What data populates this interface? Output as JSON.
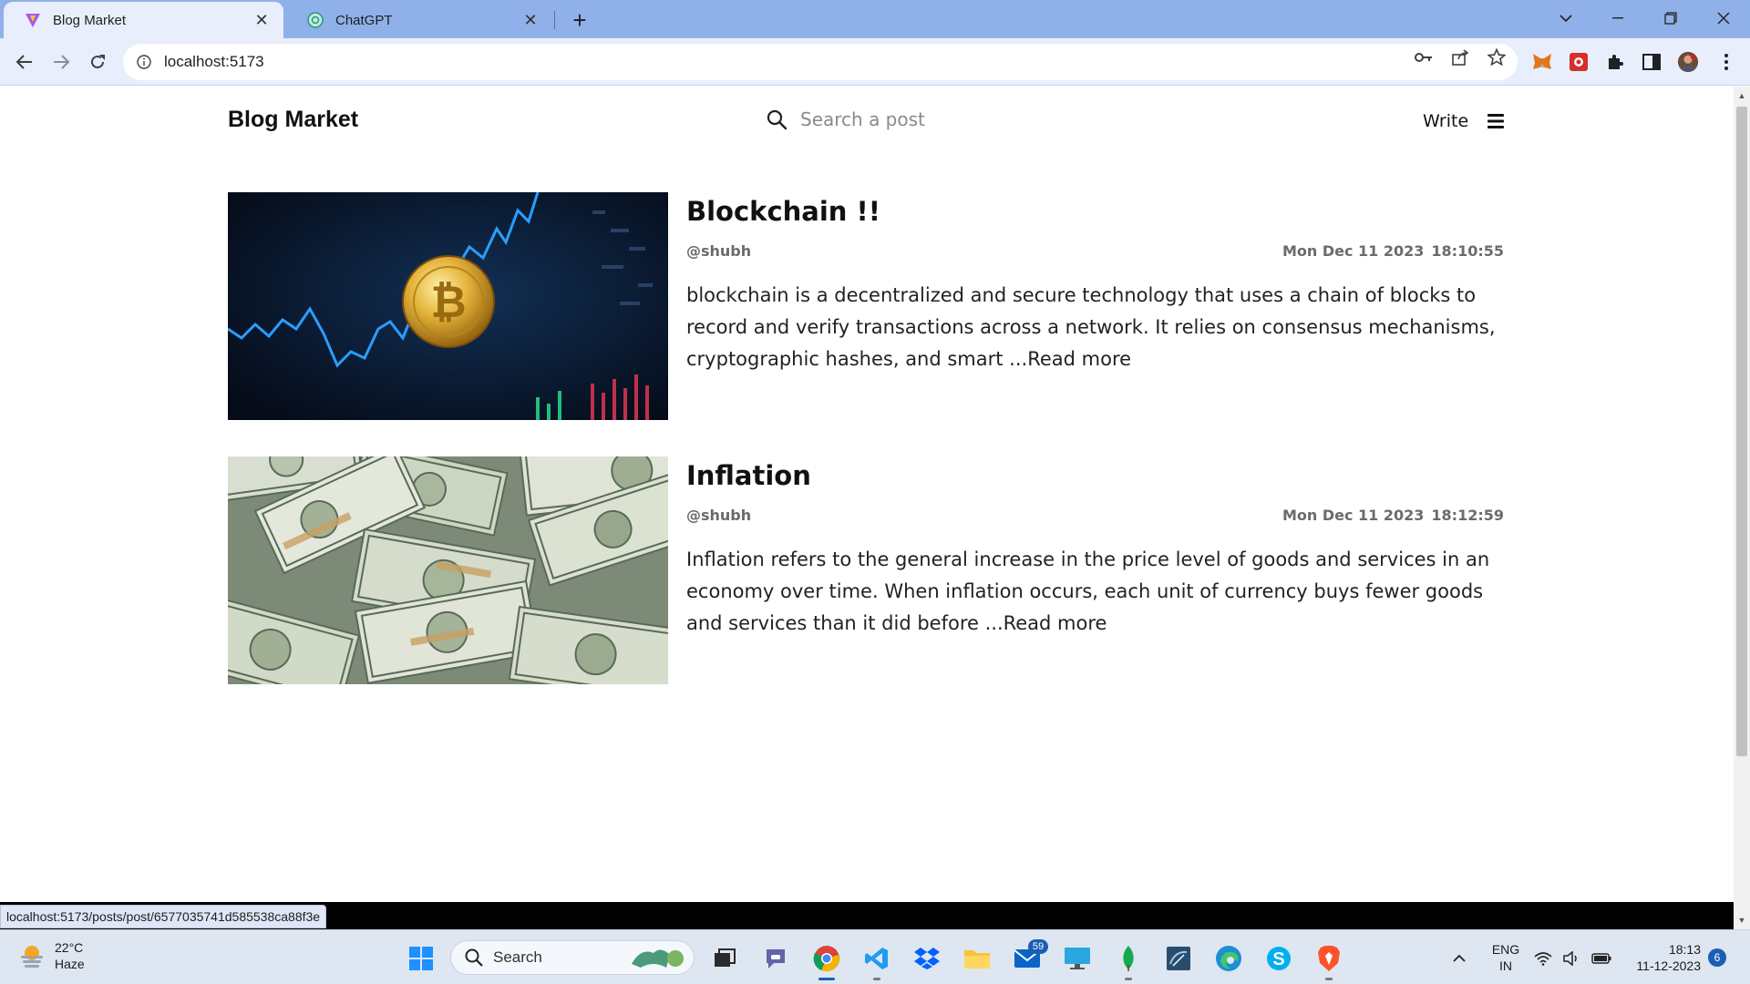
{
  "browser": {
    "tabs": [
      {
        "title": "Blog Market",
        "active": true
      },
      {
        "title": "ChatGPT",
        "active": false
      }
    ],
    "url": "localhost:5173",
    "status_url": "localhost:5173/posts/post/6577035741d585538ca88f3e"
  },
  "site": {
    "logo": "Blog Market",
    "search_placeholder": "Search a post",
    "write_label": "Write"
  },
  "posts": [
    {
      "title": "Blockchain !!",
      "author": "@shubh",
      "date": "Mon Dec 11 2023",
      "time": "18:10:55",
      "excerpt": "blockchain is a decentralized and secure technology that uses a chain of blocks to record and verify transactions across a network. It relies on consensus mechanisms, cryptographic hashes, and smart ...Read more",
      "image": "bitcoin-chart-image"
    },
    {
      "title": "Inflation",
      "author": "@shubh",
      "date": "Mon Dec 11 2023",
      "time": "18:12:59",
      "excerpt": "Inflation refers to the general increase in the price level of goods and services in an economy over time. When inflation occurs, each unit of currency buys fewer goods and services than it did before ...Read more",
      "image": "dollar-bills-image"
    }
  ],
  "taskbar": {
    "weather_temp": "22°C",
    "weather_desc": "Haze",
    "search_label": "Search",
    "mail_count": "59",
    "lang": "ENG",
    "region": "IN",
    "time": "18:13",
    "date": "11-12-2023",
    "notifications": "6"
  },
  "colors": {
    "tabbar": "#8fb0e8",
    "toolbar": "#e8eefb",
    "taskbar": "#dee6f1",
    "accent": "#1a5fb4"
  }
}
